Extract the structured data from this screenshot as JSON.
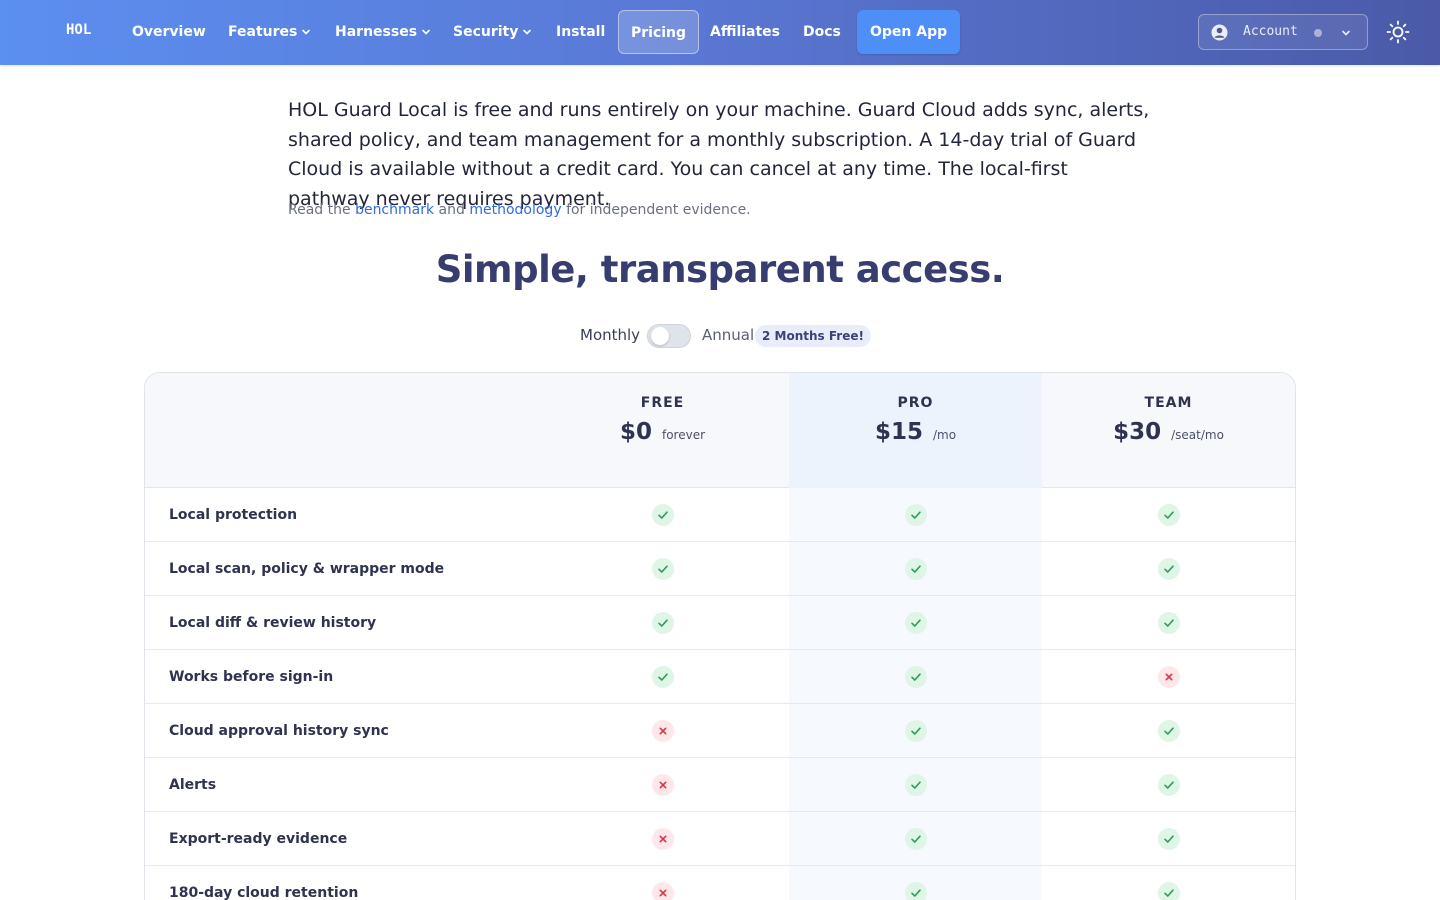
{
  "nav": {
    "logo": "HOL",
    "items": [
      {
        "label": "Overview",
        "dropdown": false
      },
      {
        "label": "Features",
        "dropdown": true
      },
      {
        "label": "Harnesses",
        "dropdown": true
      },
      {
        "label": "Security",
        "dropdown": true
      },
      {
        "label": "Install",
        "dropdown": false
      },
      {
        "label": "Pricing",
        "dropdown": false,
        "active": true
      },
      {
        "label": "Affiliates",
        "dropdown": false
      },
      {
        "label": "Docs",
        "dropdown": false
      }
    ],
    "open_app": "Open App",
    "account": "Account",
    "theme_icon": "sun-icon"
  },
  "intro": {
    "paragraph": "HOL Guard Local is free and runs entirely on your machine. Guard Cloud adds sync, alerts, shared policy, and team management for a monthly subscription. A 14-day trial of Guard Cloud is available without a credit card. You can cancel at any time. The local-first pathway never requires payment.",
    "sub_prefix": "Read the",
    "link_benchmark": "benchmark",
    "sub_and": "and",
    "link_methodology": "methodology",
    "sub_suffix": "for independent evidence."
  },
  "headline": "Simple, transparent access.",
  "billing": {
    "monthly": "Monthly",
    "annual": "Annual",
    "badge": "2 Months Free!",
    "annual_selected": false
  },
  "plans": [
    {
      "name": "FREE",
      "price": "$0",
      "period": "forever"
    },
    {
      "name": "PRO",
      "price": "$15",
      "period": "/mo",
      "highlighted": true
    },
    {
      "name": "TEAM",
      "price": "$30",
      "period": "/seat/mo"
    }
  ],
  "features": [
    {
      "label": "Local protection",
      "free": true,
      "pro": true,
      "team": true
    },
    {
      "label": "Local scan, policy & wrapper mode",
      "free": true,
      "pro": true,
      "team": true
    },
    {
      "label": "Local diff & review history",
      "free": true,
      "pro": true,
      "team": true
    },
    {
      "label": "Works before sign-in",
      "free": true,
      "pro": true,
      "team": false
    },
    {
      "label": "Cloud approval history sync",
      "free": false,
      "pro": true,
      "team": true
    },
    {
      "label": "Alerts",
      "free": false,
      "pro": true,
      "team": true
    },
    {
      "label": "Export-ready evidence",
      "free": false,
      "pro": true,
      "team": true
    },
    {
      "label": "180-day cloud retention",
      "free": false,
      "pro": true,
      "team": true
    }
  ],
  "colors": {
    "nav_start": "#5b8ff0",
    "nav_end": "#4a5aa8",
    "accent": "#4e8ef7",
    "headline": "#373d6e",
    "check": "#2e9d5b",
    "cross": "#d9344a"
  }
}
